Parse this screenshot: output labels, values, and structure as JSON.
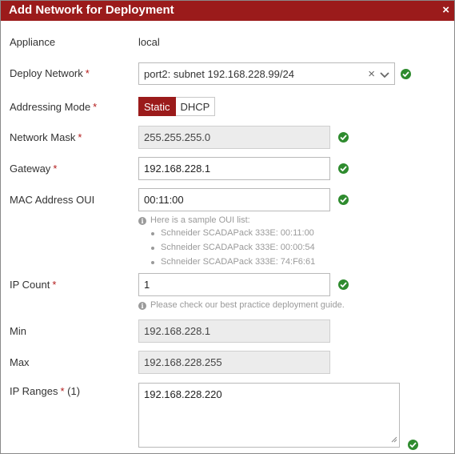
{
  "dialog": {
    "title": "Add Network for Deployment",
    "close_glyph": "×"
  },
  "fields": {
    "appliance": {
      "label": "Appliance",
      "value": "local"
    },
    "deploy_network": {
      "label": "Deploy Network",
      "required": "*",
      "value": "port2: subnet 192.168.228.99/24",
      "clear_glyph": "×"
    },
    "addressing_mode": {
      "label": "Addressing Mode",
      "required": "*",
      "options": [
        "Static",
        "DHCP"
      ],
      "selected": "Static"
    },
    "network_mask": {
      "label": "Network Mask",
      "required": "*",
      "value": "255.255.255.0"
    },
    "gateway": {
      "label": "Gateway",
      "required": "*",
      "value": "192.168.228.1"
    },
    "mac_oui": {
      "label": "MAC Address OUI",
      "value": "00:11:00",
      "hint": "Here is a sample OUI list:",
      "samples": [
        "Schneider SCADAPack 333E: 00:11:00",
        "Schneider SCADAPack 333E: 00:00:54",
        "Schneider SCADAPack 333E: 74:F6:61"
      ]
    },
    "ip_count": {
      "label": "IP Count",
      "required": "*",
      "value": "1",
      "hint": "Please check our best practice deployment guide."
    },
    "min": {
      "label": "Min",
      "value": "192.168.228.1"
    },
    "max": {
      "label": "Max",
      "value": "192.168.228.255"
    },
    "ip_ranges": {
      "label": "IP Ranges",
      "required": "*",
      "count": "(1)",
      "value": "192.168.228.220"
    }
  },
  "icons": {
    "valid": "check-circle-icon",
    "info": "info-icon",
    "dropdown": "chevron-down-icon",
    "close": "close-icon"
  },
  "colors": {
    "brand": "#9b1b1b",
    "valid": "#2e8b2e",
    "required": "#b31b1b",
    "hint": "#9a9a9a",
    "readonly_bg": "#ececec"
  }
}
